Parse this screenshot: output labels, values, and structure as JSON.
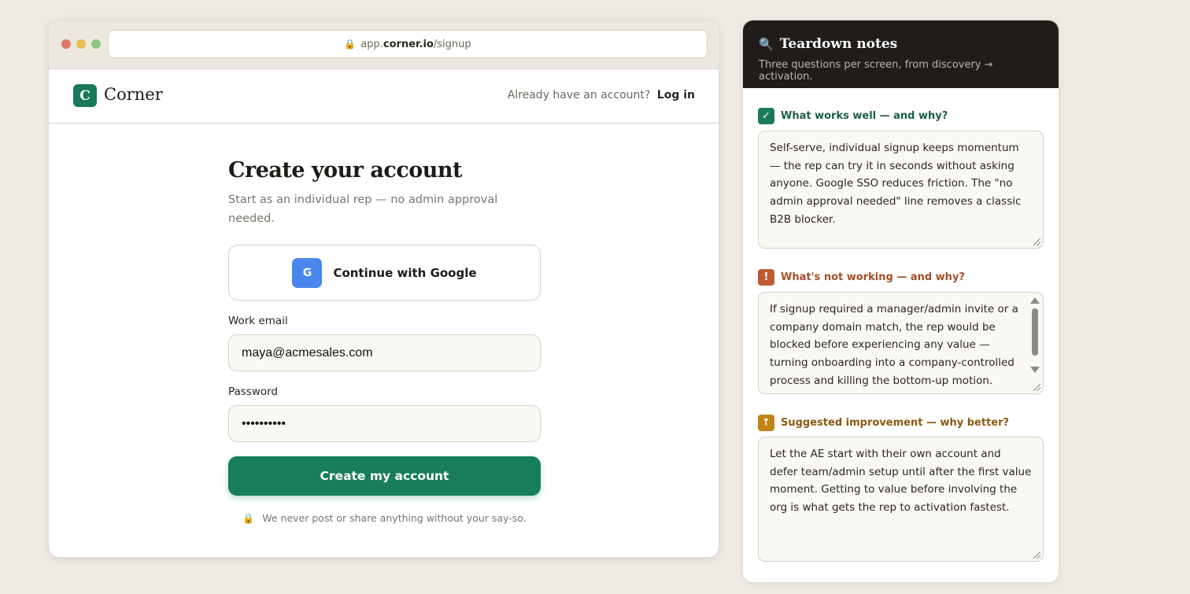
{
  "browser": {
    "url_prefix": "app.",
    "url_host": "corner.io",
    "url_path": "/signup",
    "lock_icon": "🔒"
  },
  "app": {
    "logo_letter": "C",
    "logo_name": "Corner",
    "have_account_text": "Already have an account?",
    "login_label": "Log in"
  },
  "signup": {
    "title": "Create your account",
    "subtitle": "Start as an individual rep — no admin approval needed.",
    "google_icon_letter": "G",
    "google_label": "Continue with Google",
    "email_label": "Work email",
    "email_value": "maya@acmesales.com",
    "password_label": "Password",
    "password_value": "••••••••••",
    "submit_label": "Create my account",
    "privacy_text": "We never post or share anything without your say-so."
  },
  "notes": {
    "icon": "🔍",
    "title": "Teardown notes",
    "subtitle": "Three questions per screen, from discovery → activation.",
    "questions": [
      {
        "badge": "✓",
        "label": "What works well — and why?",
        "answer": "Self-serve, individual signup keeps momentum — the rep can try it in seconds without asking anyone. Google SSO reduces friction. The \"no admin approval needed\" line removes a classic B2B blocker."
      },
      {
        "badge": "!",
        "label": "What's not working — and why?",
        "answer": "If signup required a manager/admin invite or a company domain match, the rep would be blocked before experiencing any value — turning onboarding into a company-controlled process and killing the bottom-up motion."
      },
      {
        "badge": "↑",
        "label": "Suggested improvement — why better?",
        "answer": "Let the AE start with their own account and defer team/admin setup until after the first value moment. Getting to value before involving the org is what gets the rep to activation fastest."
      }
    ]
  },
  "colors": {
    "brand_green": "#177d5d",
    "good": "#1b7a5a",
    "bad": "#c05a33",
    "improve": "#c08416"
  }
}
